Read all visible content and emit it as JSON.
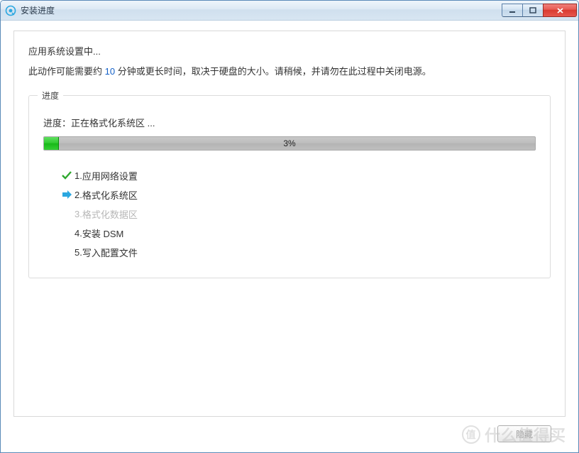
{
  "window": {
    "title": "安装进度"
  },
  "main": {
    "line1": "应用系统设置中...",
    "line2_pre": "此动作可能需要约 ",
    "line2_minutes": "10",
    "line2_post": " 分钟或更长时间，取决于硬盘的大小。请稍候，并请勿在此过程中关闭电源。"
  },
  "panel": {
    "legend": "进度",
    "status_prefix": "进度：",
    "status_text": "正在格式化系统区 ...",
    "progress_percent": 3,
    "progress_label": "3%"
  },
  "steps": [
    {
      "num": "1.",
      "label": "应用网络设置",
      "state": "done"
    },
    {
      "num": "2.",
      "label": "格式化系统区",
      "state": "active"
    },
    {
      "num": "3.",
      "label": "格式化数据区",
      "state": "pending"
    },
    {
      "num": "4.",
      "label": "安装 DSM",
      "state": "todo"
    },
    {
      "num": "5.",
      "label": "写入配置文件",
      "state": "todo"
    }
  ],
  "footer": {
    "hide_button": "隐藏"
  },
  "watermark": "什么值得买"
}
